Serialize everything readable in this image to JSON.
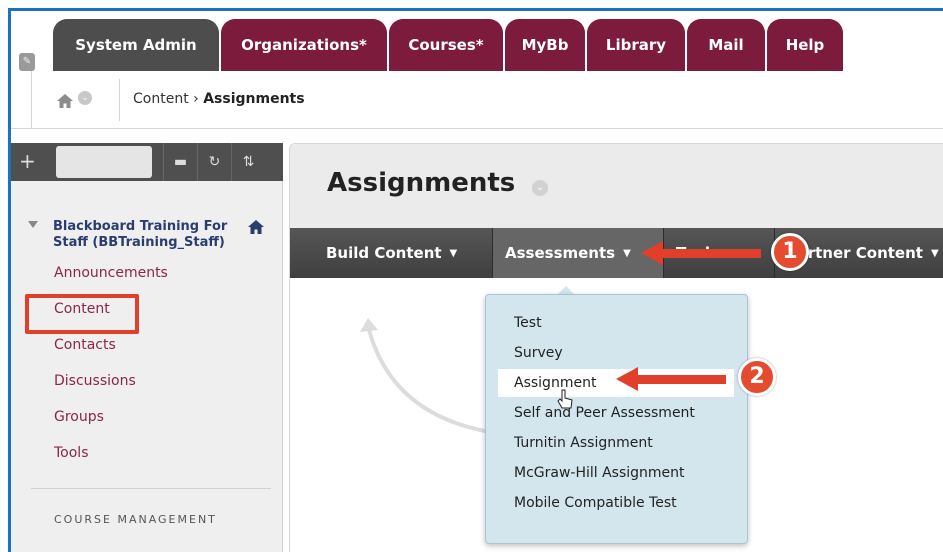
{
  "tabs": [
    {
      "label": "System Admin",
      "active": true
    },
    {
      "label": "Organizations*"
    },
    {
      "label": "Courses*"
    },
    {
      "label": "MyBb"
    },
    {
      "label": "Library"
    },
    {
      "label": "Mail"
    },
    {
      "label": "Help"
    }
  ],
  "breadcrumb": {
    "path": "Content",
    "separator": "›",
    "current": "Assignments"
  },
  "sidebar": {
    "add_label": "+",
    "course_title": "Blackboard Training For Staff (BBTraining_Staff)",
    "links": [
      "Announcements",
      "Content",
      "Contacts",
      "Discussions",
      "Groups",
      "Tools"
    ],
    "section_label": "COURSE MANAGEMENT"
  },
  "page": {
    "title": "Assignments"
  },
  "action_bar": {
    "items": [
      "Build Content",
      "Assessments",
      "Tools",
      "Partner Content"
    ]
  },
  "dropdown": {
    "items": [
      "Test",
      "Survey",
      "Assignment",
      "Self and Peer Assessment",
      "Turnitin Assignment",
      "McGraw-Hill Assignment",
      "Mobile Compatible Test"
    ],
    "highlighted": "Assignment"
  },
  "annotations": {
    "step1": "1",
    "step2": "2"
  },
  "colors": {
    "accent_tab": "#7d1b3c",
    "annotation": "#e0402b",
    "frame": "#1b73bf",
    "link": "#8a2744"
  }
}
